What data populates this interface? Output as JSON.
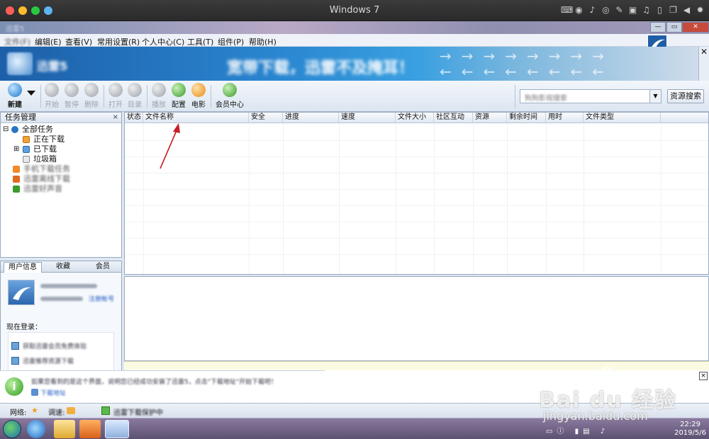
{
  "host": {
    "title": "Windows 7",
    "traffic_lights": [
      "#fc5f57",
      "#fdbc2e",
      "#29c841",
      "#5eb3f0"
    ],
    "icons": [
      "keyboard-icon",
      "record-icon",
      "microphone-icon",
      "capture-icon",
      "no-touch-icon",
      "save-icon",
      "volume-icon",
      "tablet-icon",
      "copy-icon",
      "play-left-icon",
      "settings-icon"
    ]
  },
  "app": {
    "title": "迅雷5",
    "menu": [
      {
        "label": "文件(F)",
        "blurred": true
      },
      {
        "label": "编辑(E)",
        "blurred": false
      },
      {
        "label": "查看(V)",
        "blurred": false
      },
      {
        "label": "常用设置(R)",
        "blurred": false
      },
      {
        "label": "个人中心(C)",
        "blurred": false
      },
      {
        "label": "工具(T)",
        "blurred": false
      },
      {
        "label": "组件(P)",
        "blurred": false
      },
      {
        "label": "帮助(H)",
        "blurred": false
      }
    ],
    "banner": {
      "logo_text": "迅雷5",
      "slogan": "宽带下载，迅雷不及掩耳！",
      "arrows": "→→→→→→→→ ←←←←←←←←"
    },
    "toolbar": {
      "buttons": [
        {
          "name": "new",
          "label": "新建",
          "enabled": true,
          "color": "blue"
        },
        {
          "name": "start",
          "label": "开始",
          "enabled": false,
          "color": "gray"
        },
        {
          "name": "pause",
          "label": "暂停",
          "enabled": false,
          "color": "gray"
        },
        {
          "name": "delete",
          "label": "删除",
          "enabled": false,
          "color": "gray"
        },
        {
          "name": "open",
          "label": "打开",
          "enabled": false,
          "color": "gray"
        },
        {
          "name": "directory",
          "label": "目录",
          "enabled": false,
          "color": "gray"
        },
        {
          "name": "play",
          "label": "播放",
          "enabled": false,
          "color": "gray"
        },
        {
          "name": "config",
          "label": "配置",
          "enabled": true,
          "color": "green"
        },
        {
          "name": "movie",
          "label": "电影",
          "enabled": true,
          "color": "orange"
        },
        {
          "name": "vip-center",
          "label": "会员中心",
          "enabled": true,
          "color": "green"
        }
      ],
      "search_placeholder": "狗狗影视搜索",
      "search_button": "资源搜索"
    },
    "task_panel": {
      "title": "任务管理",
      "close": "×",
      "tree": [
        {
          "label": "全部任务",
          "depth": 0,
          "expander": "⊟",
          "icon": "all-tasks-icon",
          "blurred": false
        },
        {
          "label": "正在下载",
          "depth": 1,
          "expander": "",
          "icon": "downloading-icon",
          "blurred": false
        },
        {
          "label": "已下载",
          "depth": 1,
          "expander": "⊞",
          "icon": "downloaded-icon",
          "blurred": false
        },
        {
          "label": "垃圾箱",
          "depth": 1,
          "expander": "",
          "icon": "trash-icon",
          "blurred": false
        },
        {
          "label": "手机下载任务",
          "depth": 0,
          "expander": "",
          "icon": "phone-icon",
          "blurred": true
        },
        {
          "label": "迅雷离线下载",
          "depth": 0,
          "expander": "",
          "icon": "offline-icon",
          "blurred": true
        },
        {
          "label": "迅雷好声音",
          "depth": 0,
          "expander": "",
          "icon": "music-icon",
          "blurred": true
        }
      ]
    },
    "user_panel": {
      "tabs": [
        "用户信息",
        "收藏",
        "会员"
      ],
      "active_tab": "用户信息",
      "now_login": "现在登录：",
      "login_link": "注册帐号",
      "blur_text_1": "您的迅雷还未登录",
      "blur_text_2": "登录后享受更多特权",
      "list_items": [
        "获取迅雷会员免费体验",
        "迅雷推荐资源下载"
      ]
    },
    "file_list": {
      "columns": [
        "状态",
        "文件名称",
        "安全",
        "进度",
        "速度",
        "文件大小",
        "社区互动",
        "资源",
        "剩余时间",
        "用时",
        "文件类型"
      ]
    },
    "notification": {
      "icon": "i",
      "text": "如果您看到的是这个界面，说明您已经成功安装了迅雷5，点击\"下载地址\"开始下载吧！",
      "link": "下载地址",
      "close": "×"
    },
    "statusbar": {
      "items": [
        "网络:",
        "调速:",
        "迅雷下载保护中"
      ]
    }
  },
  "taskbar": {
    "time": "22:29",
    "date": "2019/5/6",
    "apps": [
      "ie-icon",
      "explorer-icon",
      "media-player-icon",
      "thunder-icon"
    ]
  },
  "annotation": {
    "color": "#c81e28"
  },
  "watermark": {
    "brand": "Bai du 经验",
    "url": "jingyan.baidu.com"
  }
}
